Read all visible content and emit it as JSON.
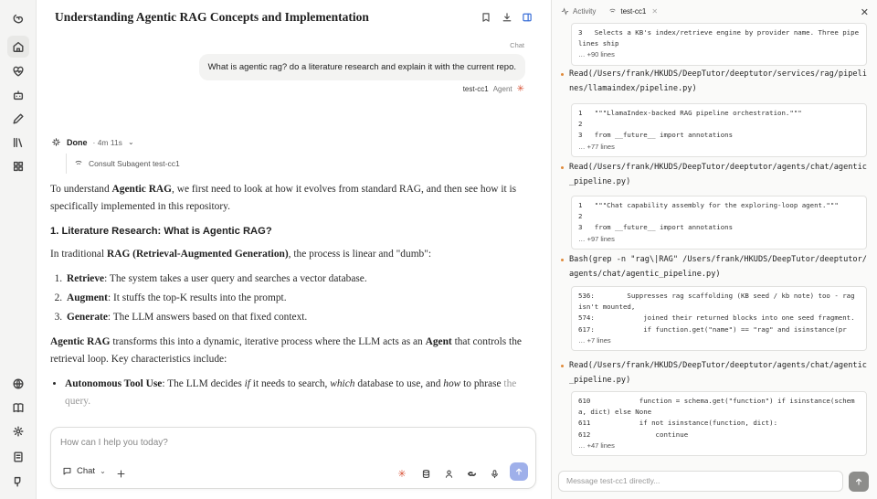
{
  "header": {
    "title": "Understanding Agentic RAG Concepts and Implementation"
  },
  "conversation": {
    "mode_label": "Chat",
    "user_message": "What is agentic rag? do a literature research and explain it with the current repo.",
    "user_meta": {
      "agent_name": "test-cc1",
      "role": "Agent"
    },
    "status": {
      "state": "Done",
      "elapsed": "· 4m 11s"
    },
    "subagent_step": "Consult Subagent test-cc1"
  },
  "answer": {
    "intro_a": "To understand ",
    "intro_b": "Agentic RAG",
    "intro_c": ", we first need to look at how it evolves from standard RAG, and then see how it is specifically implemented in this repository.",
    "heading": "1. Literature Research: What is Agentic RAG?",
    "trad_a": "In traditional ",
    "trad_b": "RAG (Retrieval-Augmented Generation)",
    "trad_c": ", the process is linear and \"dumb\":",
    "steps": [
      {
        "term": "Retrieve",
        "desc": ": The system takes a user query and searches a vector database."
      },
      {
        "term": "Augment",
        "desc": ": It stuffs the top-K results into the prompt."
      },
      {
        "term": "Generate",
        "desc": ": The LLM answers based on that fixed context."
      }
    ],
    "agentic_a": "Agentic RAG",
    "agentic_b": " transforms this into a dynamic, iterative process where the LLM acts as an ",
    "agentic_c": "Agent",
    "agentic_d": " that controls the retrieval loop. Key characteristics include:",
    "bullet_term": "Autonomous Tool Use",
    "bullet_a": ": The LLM decides ",
    "bullet_if": "if",
    "bullet_b": " it needs to search, ",
    "bullet_which": "which",
    "bullet_c": " database to use, and ",
    "bullet_how": "how",
    "bullet_d": " to phrase ",
    "bullet_fade": "the query."
  },
  "composer": {
    "placeholder": "How can I help you today?",
    "mode": "Chat"
  },
  "panel": {
    "tabs": [
      {
        "label": "Activity"
      },
      {
        "label": "test-cc1"
      }
    ],
    "message_placeholder": "Message test-cc1 directly...",
    "log": [
      {
        "kind": "snippet",
        "lines": "3   Selects a KB's index/retrieve engine by provider name. Three pipelines ship",
        "more": "… +90 lines"
      },
      {
        "kind": "step",
        "text": "Read(/Users/frank/HKUDS/DeepTutor/deeptutor/services/rag/pipelines/llamaindex/pipeline.py)"
      },
      {
        "kind": "snippet",
        "lines": "1   \"\"\"LlamaIndex-backed RAG pipeline orchestration.\"\"\"\n2\n3   from __future__ import annotations",
        "more": "… +77 lines"
      },
      {
        "kind": "step",
        "text": "Read(/Users/frank/HKUDS/DeepTutor/deeptutor/agents/chat/agentic_pipeline.py)"
      },
      {
        "kind": "snippet",
        "lines": "1   \"\"\"Chat capability assembly for the exploring-loop agent.\"\"\"\n2\n3   from __future__ import annotations",
        "more": "… +97 lines"
      },
      {
        "kind": "step",
        "text": "Bash(grep -n \"rag\\|RAG\" /Users/frank/HKUDS/DeepTutor/deeptutor/agents/chat/agentic_pipeline.py)"
      },
      {
        "kind": "snippet",
        "lines": "536:        Suppresses rag scaffolding (KB seed / kb note) too - rag isn't mounted,\n574:            joined their returned blocks into one seed fragment.\n617:            if function.get(\"name\") == \"rag\" and isinstance(pr",
        "more": "… +7 lines"
      },
      {
        "kind": "step",
        "text": "Read(/Users/frank/HKUDS/DeepTutor/deeptutor/agents/chat/agentic_pipeline.py)"
      },
      {
        "kind": "snippet",
        "lines": "610            function = schema.get(\"function\") if isinstance(schema, dict) else None\n611            if not isinstance(function, dict):\n612                continue",
        "more": "… +47 lines"
      }
    ]
  },
  "colors": {
    "accent": "#d9553a",
    "send": "#9fb0ea",
    "dot": "#e08a3a"
  }
}
